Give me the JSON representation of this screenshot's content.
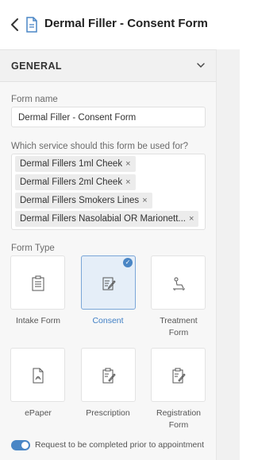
{
  "header": {
    "title": "Dermal Filler - Consent Form"
  },
  "section": {
    "title": "GENERAL"
  },
  "form_name": {
    "label": "Form name",
    "value": "Dermal Filler - Consent Form"
  },
  "services": {
    "label": "Which service should this form be used for?",
    "chips": [
      "Dermal Fillers 1ml Cheek",
      "Dermal Fillers 2ml Cheek",
      "Dermal Fillers Smokers Lines",
      "Dermal Fillers Nasolabial OR Marionett..."
    ],
    "remove_glyph": "×"
  },
  "form_type": {
    "label": "Form Type",
    "selected": "Consent",
    "options": [
      {
        "name": "Intake Form",
        "icon": "clipboard-list-icon"
      },
      {
        "name": "Consent",
        "icon": "document-edit-icon"
      },
      {
        "name": "Treatment",
        "name2": "Form",
        "icon": "treatment-chair-icon"
      },
      {
        "name": "ePaper",
        "icon": "pdf-file-icon"
      },
      {
        "name": "Prescription",
        "icon": "clipboard-pen-icon"
      },
      {
        "name": "Registration",
        "name2": "Form",
        "icon": "clipboard-pen-icon"
      }
    ]
  },
  "toggle": {
    "label": "Request to be completed prior to appointment",
    "on": true
  },
  "colors": {
    "accent": "#4a86c5",
    "selected_bg": "#e5eef8"
  }
}
